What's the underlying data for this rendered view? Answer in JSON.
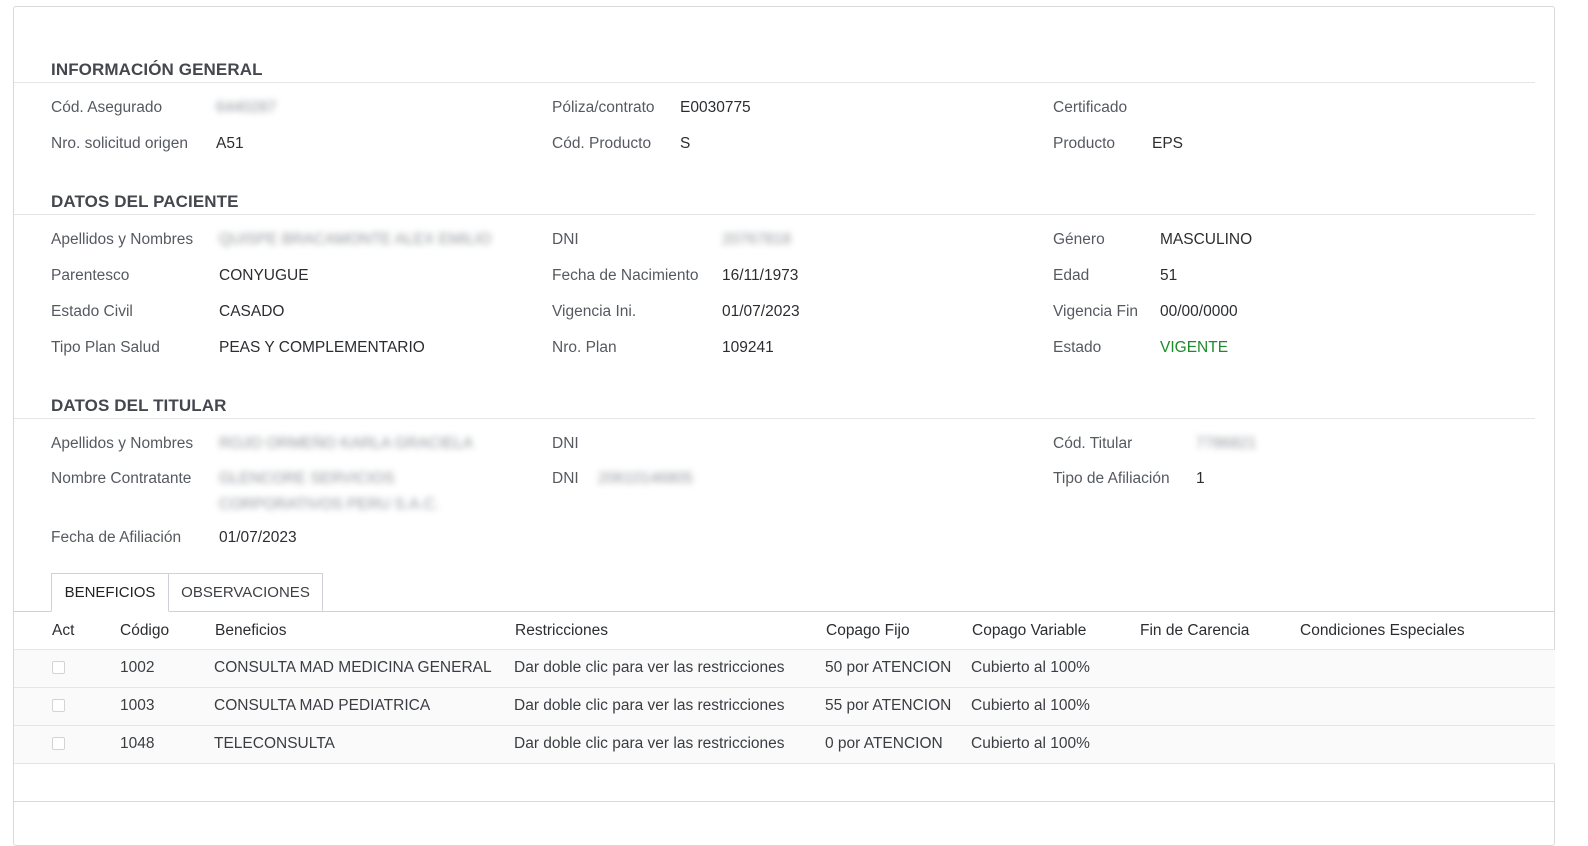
{
  "general": {
    "title": "INFORMACIÓN GENERAL",
    "fields": [
      {
        "label": "Cód. Asegurado",
        "value": "6440287"
      },
      {
        "label": "Póliza/contrato",
        "value": "E0030775"
      },
      {
        "label": "Certificado",
        "value": ""
      },
      {
        "label": "Nro. solicitud origen",
        "value": "A51"
      },
      {
        "label": "Cód. Producto",
        "value": "S"
      },
      {
        "label": "Producto",
        "value": "EPS"
      }
    ]
  },
  "paciente": {
    "title": "DATOS DEL PACIENTE",
    "fields": [
      {
        "label": "Apellidos y Nombres",
        "value": "QUISPE BRACAMONTE ALEX EMILIO"
      },
      {
        "label": "DNI",
        "value": "20767818"
      },
      {
        "label": "Género",
        "value": "MASCULINO"
      },
      {
        "label": "Parentesco",
        "value": "CONYUGUE"
      },
      {
        "label": "Fecha de Nacimiento",
        "value": "16/11/1973"
      },
      {
        "label": "Edad",
        "value": "51"
      },
      {
        "label": "Estado Civil",
        "value": "CASADO"
      },
      {
        "label": "Vigencia Ini.",
        "value": "01/07/2023"
      },
      {
        "label": "Vigencia Fin",
        "value": "00/00/0000"
      },
      {
        "label": "Tipo Plan Salud",
        "value": "PEAS Y COMPLEMENTARIO"
      },
      {
        "label": "Nro. Plan",
        "value": "109241"
      },
      {
        "label": "Estado",
        "value": "VIGENTE"
      }
    ]
  },
  "titular": {
    "title": "DATOS DEL TITULAR",
    "fields": [
      {
        "label": "Apellidos y Nombres",
        "value": "ROJO ORMEÑO KARLA GRACIELA"
      },
      {
        "label": "DNI",
        "value": ""
      },
      {
        "label": "Cód. Titular",
        "value": "7786821"
      },
      {
        "label": "Nombre Contratante",
        "value": "GLENCORE SERVICIOS CORPORATIVOS PERU S.A.C."
      },
      {
        "label": "DNI",
        "value": "20610146805"
      },
      {
        "label": "Tipo de Afiliación",
        "value": "1"
      },
      {
        "label": "Fecha de Afiliación",
        "value": "01/07/2023"
      }
    ]
  },
  "tabs": [
    {
      "label": "BENEFICIOS",
      "active": true
    },
    {
      "label": "OBSERVACIONES",
      "active": false
    }
  ],
  "table": {
    "headers": [
      "Act",
      "Código",
      "Beneficios",
      "Restricciones",
      "Copago Fijo",
      "Copago Variable",
      "Fin de Carencia",
      "Condiciones Especiales"
    ],
    "rows": [
      {
        "act": false,
        "codigo": "1002",
        "beneficio": "CONSULTA MAD MEDICINA GENERAL",
        "restricciones": "Dar doble clic para ver las restricciones",
        "copago_fijo": "50 por ATENCION",
        "copago_variable": "Cubierto al 100%",
        "fin_carencia": "",
        "condiciones": ""
      },
      {
        "act": false,
        "codigo": "1003",
        "beneficio": "CONSULTA MAD PEDIATRICA",
        "restricciones": "Dar doble clic para ver las restricciones",
        "copago_fijo": "55 por ATENCION",
        "copago_variable": "Cubierto al 100%",
        "fin_carencia": "",
        "condiciones": ""
      },
      {
        "act": false,
        "codigo": "1048",
        "beneficio": "TELECONSULTA",
        "restricciones": "Dar doble clic para ver las restricciones",
        "copago_fijo": "0 por ATENCION",
        "copago_variable": "Cubierto al 100%",
        "fin_carencia": "",
        "condiciones": ""
      }
    ]
  },
  "colors": {
    "status_active": "#1c8c2a"
  }
}
